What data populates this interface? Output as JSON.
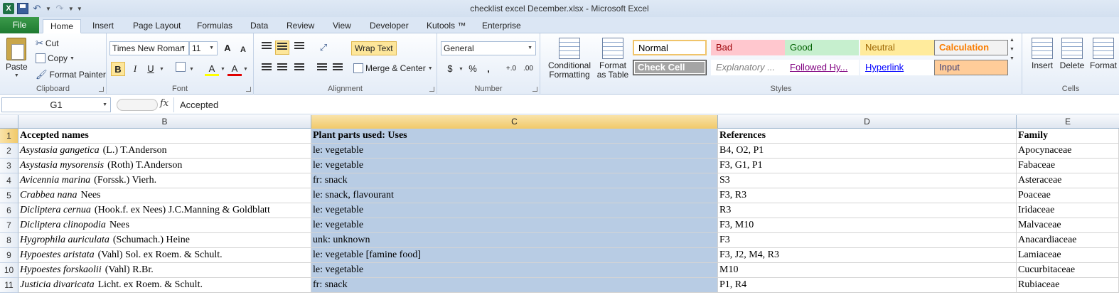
{
  "window": {
    "title": "checklist excel December.xlsx - Microsoft Excel"
  },
  "qat": {
    "logo": "X",
    "undo": "↶",
    "redo": "↷"
  },
  "tabs": [
    {
      "label": "File"
    },
    {
      "label": "Home"
    },
    {
      "label": "Insert"
    },
    {
      "label": "Page Layout"
    },
    {
      "label": "Formulas"
    },
    {
      "label": "Data"
    },
    {
      "label": "Review"
    },
    {
      "label": "View"
    },
    {
      "label": "Developer"
    },
    {
      "label": "Kutools ™"
    },
    {
      "label": "Enterprise"
    }
  ],
  "clipboard": {
    "paste": "Paste",
    "cut": "Cut",
    "copy": "Copy",
    "format_painter": "Format Painter",
    "label": "Clipboard"
  },
  "font": {
    "name": "Times New Roman",
    "size": "11",
    "grow": "A",
    "shrink": "A",
    "bold": "B",
    "italic": "I",
    "underline": "U",
    "fill": "A",
    "color": "A",
    "label": "Font"
  },
  "alignment": {
    "wrap_text": "Wrap Text",
    "merge_center": "Merge & Center",
    "label": "Alignment"
  },
  "number": {
    "format": "General",
    "currency": "$",
    "percent": "%",
    "comma": ",",
    "inc_decimal": "+.0",
    "dec_decimal": ".00",
    "label": "Number"
  },
  "styles_group": {
    "conditional": "Conditional Formatting",
    "format_table": "Format as Table",
    "label": "Styles",
    "cells": [
      {
        "label": "Normal",
        "bg": "#ffffff",
        "fg": "#000000",
        "border": "#f0c46a"
      },
      {
        "label": "Bad",
        "bg": "#ffc7ce",
        "fg": "#9c0006",
        "border": "#ffc7ce"
      },
      {
        "label": "Good",
        "bg": "#c6efce",
        "fg": "#006100",
        "border": "#c6efce"
      },
      {
        "label": "Neutral",
        "bg": "#ffeb9c",
        "fg": "#9c6500",
        "border": "#ffeb9c"
      },
      {
        "label": "Calculation",
        "bg": "#f2f2f2",
        "fg": "#fa7d00",
        "border": "#7f7f7f"
      },
      {
        "label": "Check Cell",
        "bg": "#a5a5a5",
        "fg": "#ffffff",
        "border": "#3f3f3f"
      },
      {
        "label": "Explanatory ...",
        "bg": "#ffffff",
        "fg": "#7f7f7f",
        "border": "#ffffff"
      },
      {
        "label": "Followed Hy...",
        "bg": "#ffffff",
        "fg": "#800080",
        "border": "#ffffff"
      },
      {
        "label": "Hyperlink",
        "bg": "#ffffff",
        "fg": "#0000ff",
        "border": "#ffffff"
      },
      {
        "label": "Input",
        "bg": "#ffcc99",
        "fg": "#3f3f76",
        "border": "#7f7f7f"
      }
    ]
  },
  "cells_group": {
    "insert": "Insert",
    "delete": "Delete",
    "format": "Format",
    "label": "Cells"
  },
  "formula_bar": {
    "name_box": "G1",
    "fx": "fx",
    "value": "Accepted"
  },
  "columns": [
    {
      "label": "B",
      "selected": false
    },
    {
      "label": "C",
      "selected": true
    },
    {
      "label": "D",
      "selected": false
    },
    {
      "label": "E",
      "selected": false
    }
  ],
  "rows": [
    {
      "num": "1",
      "b": "Accepted names",
      "b_author": "",
      "c": "Plant parts used: Uses",
      "d": "References",
      "e": "Family"
    },
    {
      "num": "2",
      "b": "Asystasia gangetica",
      "b_author": "(L.) T.Anderson",
      "c": "le: vegetable",
      "d": "B4, O2, P1",
      "e": "Apocynaceae"
    },
    {
      "num": "3",
      "b": "Asystasia mysorensis",
      "b_author": "(Roth) T.Anderson",
      "c": "le: vegetable",
      "d": "F3, G1, P1",
      "e": "Fabaceae"
    },
    {
      "num": "4",
      "b": "Avicennia marina",
      "b_author": "(Forssk.) Vierh.",
      "c": "fr: snack",
      "d": "S3",
      "e": "Asteraceae"
    },
    {
      "num": "5",
      "b": "Crabbea nana",
      "b_author": "Nees",
      "c": "le: snack, flavourant",
      "d": "F3, R3",
      "e": "Poaceae"
    },
    {
      "num": "6",
      "b": "Dicliptera cernua",
      "b_author": "(Hook.f. ex Nees) J.C.Manning & Goldblatt",
      "c": "le: vegetable",
      "d": "R3",
      "e": "Iridaceae"
    },
    {
      "num": "7",
      "b": "Dicliptera clinopodia",
      "b_author": "Nees",
      "c": "le: vegetable",
      "d": "F3, M10",
      "e": "Malvaceae"
    },
    {
      "num": "8",
      "b": "Hygrophila auriculata",
      "b_author": "(Schumach.) Heine",
      "c": "unk: unknown",
      "d": "F3",
      "e": "Anacardiaceae"
    },
    {
      "num": "9",
      "b": "Hypoestes aristata",
      "b_author": "(Vahl) Sol. ex Roem. & Schult.",
      "c": "le: vegetable [famine food]",
      "d": "F3, J2, M4, R3",
      "e": "Lamiaceae"
    },
    {
      "num": "10",
      "b": "Hypoestes forskaolii",
      "b_author": "(Vahl) R.Br.",
      "c": "le: vegetable",
      "d": "M10",
      "e": "Cucurbitaceae"
    },
    {
      "num": "11",
      "b": "Justicia divaricata",
      "b_author": "Licht. ex Roem. & Schult.",
      "c": "fr: snack",
      "d": "P1, R4",
      "e": "Rubiaceae"
    }
  ]
}
